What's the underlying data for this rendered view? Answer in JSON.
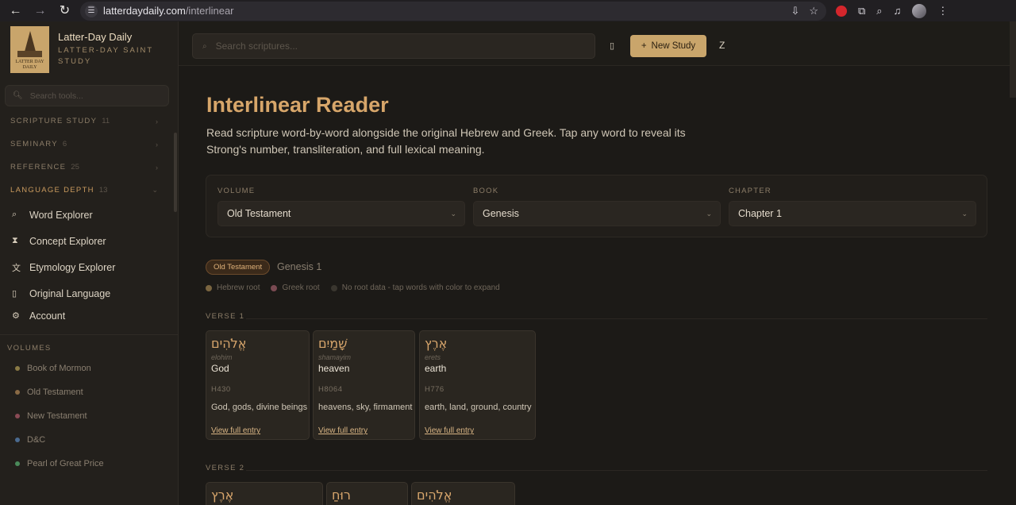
{
  "browser": {
    "url_host": "latterdaydaily.com",
    "url_path": "/interlinear"
  },
  "brand": {
    "title": "Latter-Day Daily",
    "subtitle": "LATTER-DAY SAINT STUDY",
    "logo_text": "LATTER DAY DAILY"
  },
  "sidebar": {
    "search_placeholder": "Search tools...",
    "categories": [
      {
        "label": "SCRIPTURE STUDY",
        "count": "11",
        "chevron": "›"
      },
      {
        "label": "SEMINARY",
        "count": "6",
        "chevron": "›"
      },
      {
        "label": "REFERENCE",
        "count": "25",
        "chevron": "›"
      },
      {
        "label": "LANGUAGE DEPTH",
        "count": "13",
        "chevron": "⌄"
      }
    ],
    "tools": [
      {
        "label": "Word Explorer",
        "icon": "search-icon"
      },
      {
        "label": "Concept Explorer",
        "icon": "hourglass-icon"
      },
      {
        "label": "Etymology Explorer",
        "icon": "translate-icon"
      },
      {
        "label": "Original Language",
        "icon": "book-icon"
      }
    ],
    "account_label": "Account",
    "volumes_heading": "VOLUMES",
    "volumes": [
      {
        "label": "Book of Mormon",
        "color": "#8a7a45"
      },
      {
        "label": "Old Testament",
        "color": "#8a6a45"
      },
      {
        "label": "New Testament",
        "color": "#8a4a55"
      },
      {
        "label": "D&C",
        "color": "#4a6a8f"
      },
      {
        "label": "Pearl of Great Price",
        "color": "#4a8a5a"
      }
    ]
  },
  "topbar": {
    "search_placeholder": "Search scriptures...",
    "new_study_label": "New Study",
    "new_study_icon": "+",
    "user_initial": "Z"
  },
  "main": {
    "title": "Interlinear Reader",
    "description": "Read scripture word-by-word alongside the original Hebrew and Greek. Tap any word to reveal its Strong's number, transliteration, and full lexical meaning.",
    "selectors": [
      {
        "label": "VOLUME",
        "value": "Old Testament"
      },
      {
        "label": "BOOK",
        "value": "Genesis"
      },
      {
        "label": "CHAPTER",
        "value": "Chapter 1"
      }
    ],
    "crumb_pill": "Old Testament",
    "crumb_text": "Genesis 1",
    "legend": [
      {
        "label": "Hebrew root",
        "color": "#7a6540"
      },
      {
        "label": "Greek root",
        "color": "#7a4a52"
      },
      {
        "label": "No root data - tap words with color to expand",
        "color": "#3a362f"
      }
    ],
    "verses": [
      {
        "label": "VERSE 1",
        "words": [
          {
            "hebrew": "אֱלֹהִים",
            "translit": "elohim",
            "gloss": "God",
            "strongs": "H430",
            "defs": "God, gods, divine beings",
            "link": "View full entry"
          },
          {
            "hebrew": "שָׁמַיִם",
            "translit": "shamayim",
            "gloss": "heaven",
            "strongs": "H8064",
            "defs": "heavens, sky, firmament",
            "link": "View full entry"
          },
          {
            "hebrew": "אֶרֶץ",
            "translit": "erets",
            "gloss": "earth",
            "strongs": "H776",
            "defs": "earth, land, ground, country",
            "link": "View full entry"
          }
        ]
      },
      {
        "label": "VERSE 2",
        "words": [
          {
            "hebrew": "אֶרֶץ"
          },
          {
            "hebrew": "רוּחַ"
          },
          {
            "hebrew": "אֱלֹהִים"
          }
        ]
      }
    ]
  }
}
